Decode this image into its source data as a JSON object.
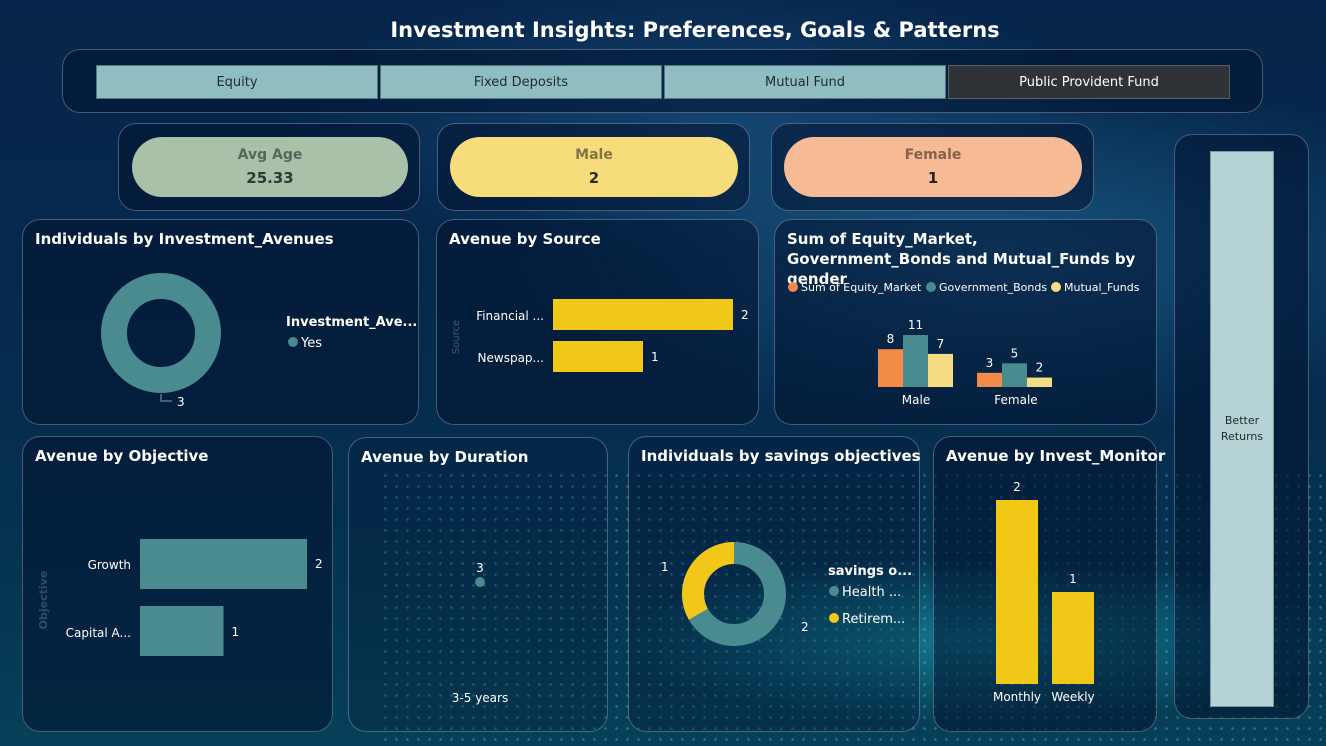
{
  "page": {
    "title": "Investment Insights: Preferences, Goals & Patterns"
  },
  "slicer": {
    "tabs": [
      "Equity",
      "Fixed Deposits",
      "Mutual Fund",
      "Public Provident Fund"
    ],
    "selected": "Public Provident Fund"
  },
  "cards": {
    "avg_age": {
      "label": "Avg Age",
      "value": "25.33"
    },
    "male": {
      "label": "Male",
      "value": "2"
    },
    "female": {
      "label": "Female",
      "value": "1"
    }
  },
  "side_card": {
    "label": "Better Returns"
  },
  "colors": {
    "teal": "#4a8b8f",
    "yellow": "#f1c718",
    "orange": "#f28b47",
    "cream": "#f8dc83",
    "pill_sage": "#a9c0a9",
    "pill_yellow": "#f7dc7c",
    "pill_peach": "#f6bb94",
    "side": "#b5d3d5"
  },
  "chart_data": [
    {
      "id": "investment_avenues",
      "type": "pie",
      "title": "Individuals by Investment_Avenues",
      "legend_title": "Investment_Ave...",
      "slices": [
        {
          "name": "Yes",
          "value": 3
        }
      ],
      "legend": "right"
    },
    {
      "id": "avenue_by_source",
      "type": "bar",
      "orientation": "horizontal",
      "title": "Avenue by Source",
      "ylabel": "Source",
      "categories": [
        "Financial ...",
        "Newspap..."
      ],
      "values": [
        2,
        1
      ],
      "xlim": [
        0,
        2
      ]
    },
    {
      "id": "sum_by_gender",
      "type": "bar",
      "title": "Sum of Equity_Market, Government_Bonds and Mutual_Funds by gender",
      "categories": [
        "Male",
        "Female"
      ],
      "legend": "top",
      "series": [
        {
          "name": "Sum of Equity_Market",
          "values": [
            8,
            3
          ]
        },
        {
          "name": "Government_Bonds",
          "values": [
            11,
            5
          ]
        },
        {
          "name": "Mutual_Funds",
          "values": [
            7,
            2
          ]
        }
      ]
    },
    {
      "id": "avenue_by_objective",
      "type": "bar",
      "orientation": "horizontal",
      "title": "Avenue by Objective",
      "ylabel": "Objective",
      "categories": [
        "Growth",
        "Capital A..."
      ],
      "values": [
        2,
        1
      ],
      "xlim": [
        0,
        2
      ]
    },
    {
      "id": "avenue_by_duration",
      "type": "scatter",
      "title": "Avenue by Duration",
      "categories": [
        "3-5 years"
      ],
      "values": [
        3
      ]
    },
    {
      "id": "savings_objectives",
      "type": "pie",
      "title": "Individuals by savings objectives",
      "legend_title": "savings o...",
      "legend": "right",
      "slices": [
        {
          "name": "Health ...",
          "value": 2
        },
        {
          "name": "Retirem...",
          "value": 1
        }
      ]
    },
    {
      "id": "invest_monitor",
      "type": "bar",
      "title": "Avenue by Invest_Monitor",
      "categories": [
        "Monthly",
        "Weekly"
      ],
      "values": [
        2,
        1
      ],
      "ylim": [
        0,
        2
      ]
    }
  ]
}
